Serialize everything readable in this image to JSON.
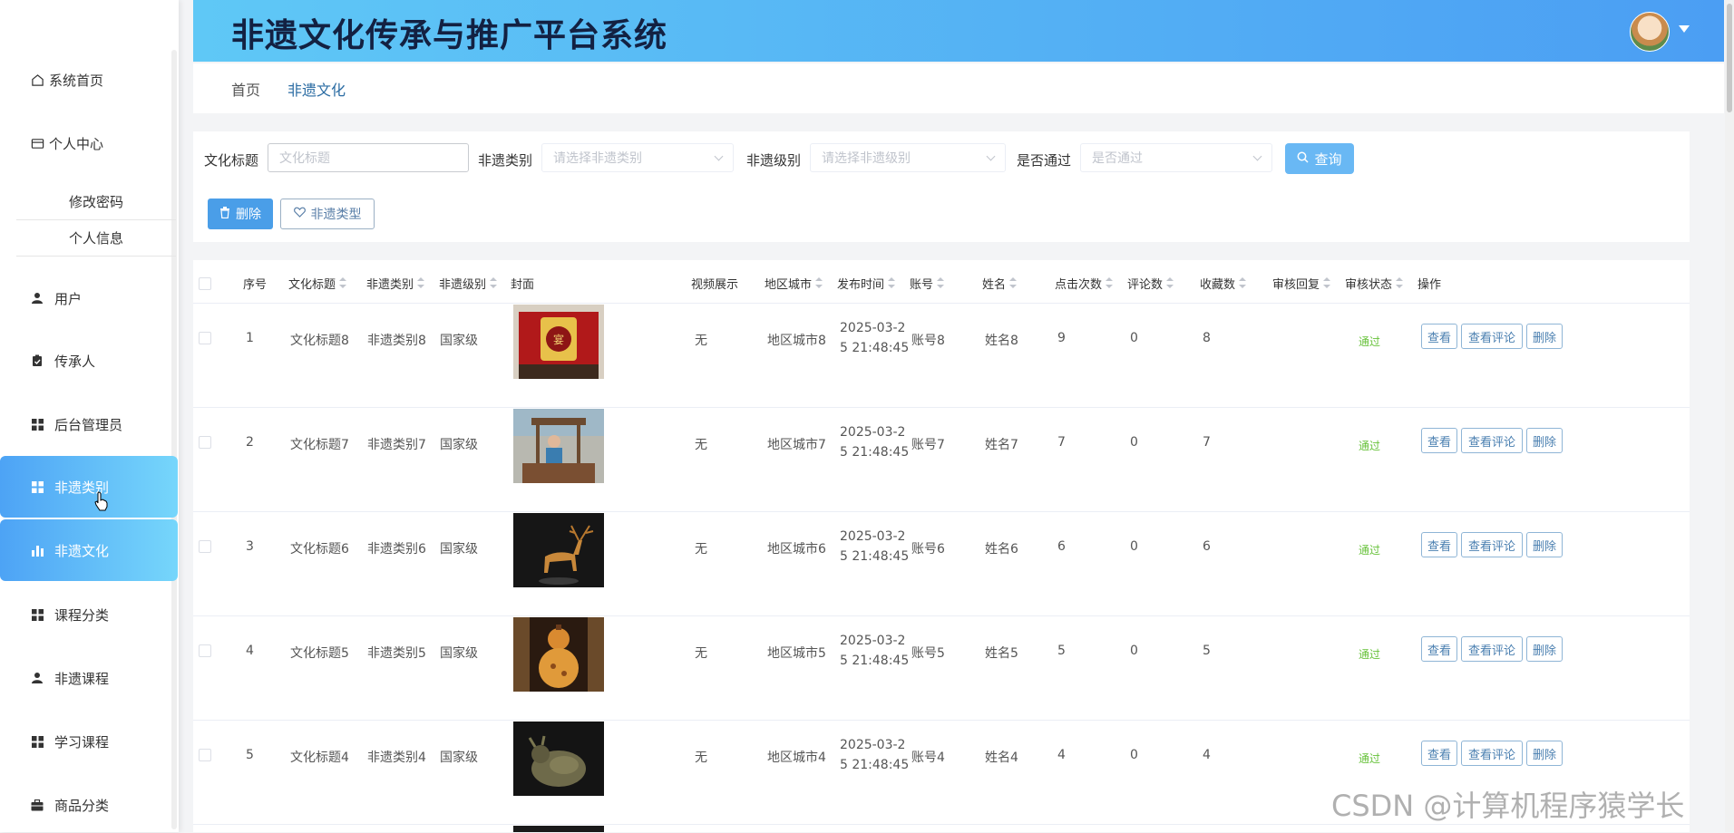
{
  "header": {
    "title": "非遗文化传承与推广平台系统"
  },
  "sidebar": {
    "items": [
      {
        "label": "系统首页",
        "icon": "home-icon"
      },
      {
        "label": "个人中心",
        "icon": "wallet-icon"
      },
      {
        "label": "修改密码"
      },
      {
        "label": "个人信息"
      },
      {
        "label": "用户",
        "icon": "user-icon"
      },
      {
        "label": "传承人",
        "icon": "clipboard-icon"
      },
      {
        "label": "后台管理员",
        "icon": "grid-icon"
      },
      {
        "label": "非遗类别",
        "icon": "grid-icon",
        "active": true
      },
      {
        "label": "非遗文化",
        "icon": "bar-chart-icon",
        "active": true
      },
      {
        "label": "课程分类",
        "icon": "grid-icon"
      },
      {
        "label": "非遗课程",
        "icon": "user-icon"
      },
      {
        "label": "学习课程",
        "icon": "grid-icon"
      },
      {
        "label": "商品分类",
        "icon": "briefcase-icon"
      }
    ]
  },
  "breadcrumb": {
    "home": "首页",
    "current": "非遗文化"
  },
  "search": {
    "title_label": "文化标题",
    "title_placeholder": "文化标题",
    "category_label": "非遗类别",
    "category_placeholder": "请选择非遗类别",
    "level_label": "非遗级别",
    "level_placeholder": "请选择非遗级别",
    "pass_label": "是否通过",
    "pass_placeholder": "是否通过",
    "query_button": "查询"
  },
  "actions": {
    "delete_button": "删除",
    "type_button": "非遗类型"
  },
  "table": {
    "headers": {
      "index": "序号",
      "title": "文化标题",
      "category": "非遗类别",
      "level": "非遗级别",
      "cover": "封面",
      "video": "视频展示",
      "city": "地区城市",
      "time": "发布时间",
      "account": "账号",
      "name": "姓名",
      "clicks": "点击次数",
      "comments": "评论数",
      "favorites": "收藏数",
      "reply": "审核回复",
      "status": "审核状态",
      "ops": "操作"
    },
    "op_labels": {
      "view": "查看",
      "comments": "查看评论",
      "delete": "删除"
    },
    "rows": [
      {
        "index": "1",
        "title": "文化标题8",
        "category": "非遗类别8",
        "level": "国家级",
        "video": "无",
        "city": "地区城市8",
        "time1": "2025-03-2",
        "time2": "5 21:48:45",
        "account": "账号8",
        "name": "姓名8",
        "clicks": "9",
        "comments": "0",
        "favorites": "8",
        "status": "通过"
      },
      {
        "index": "2",
        "title": "文化标题7",
        "category": "非遗类别7",
        "level": "国家级",
        "video": "无",
        "city": "地区城市7",
        "time1": "2025-03-2",
        "time2": "5 21:48:45",
        "account": "账号7",
        "name": "姓名7",
        "clicks": "7",
        "comments": "0",
        "favorites": "7",
        "status": "通过"
      },
      {
        "index": "3",
        "title": "文化标题6",
        "category": "非遗类别6",
        "level": "国家级",
        "video": "无",
        "city": "地区城市6",
        "time1": "2025-03-2",
        "time2": "5 21:48:45",
        "account": "账号6",
        "name": "姓名6",
        "clicks": "6",
        "comments": "0",
        "favorites": "6",
        "status": "通过"
      },
      {
        "index": "4",
        "title": "文化标题5",
        "category": "非遗类别5",
        "level": "国家级",
        "video": "无",
        "city": "地区城市5",
        "time1": "2025-03-2",
        "time2": "5 21:48:45",
        "account": "账号5",
        "name": "姓名5",
        "clicks": "5",
        "comments": "0",
        "favorites": "5",
        "status": "通过"
      },
      {
        "index": "5",
        "title": "文化标题4",
        "category": "非遗类别4",
        "level": "国家级",
        "video": "无",
        "city": "地区城市4",
        "time1": "2025-03-2",
        "time2": "5 21:48:45",
        "account": "账号4",
        "name": "姓名4",
        "clicks": "4",
        "comments": "0",
        "favorites": "4",
        "status": "通过"
      }
    ]
  },
  "watermark": "CSDN @计算机程序猿学长"
}
